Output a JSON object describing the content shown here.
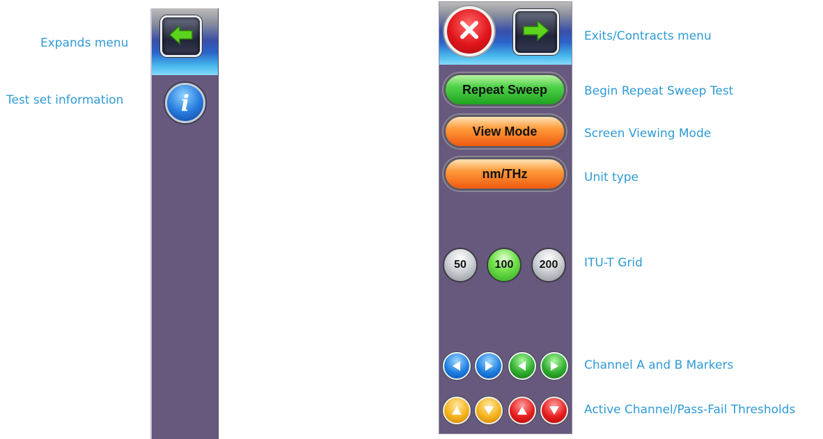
{
  "callouts": {
    "expands_menu": "Expands menu",
    "test_set_information": "Test set information",
    "exits_contracts_menu": "Exits/Contracts menu",
    "begin_repeat_sweep": "Begin Repeat Sweep Test",
    "screen_viewing_mode": "Screen Viewing Mode",
    "unit_type": "Unit type",
    "itu_t_grid": "ITU-T Grid",
    "channel_markers": "Channel A and B Markers",
    "active_channel_thresholds": "Active Channel/Pass-Fail Thresholds"
  },
  "collapsed_panel": {
    "expand_icon": "arrow-left-icon",
    "info_icon": "info-icon",
    "info_glyph": "i"
  },
  "expanded_panel": {
    "close_icon": "close-icon",
    "contract_icon": "arrow-right-icon",
    "repeat_sweep_label": "Repeat Sweep",
    "view_mode_label": "View Mode",
    "unit_label": "nm/THz",
    "grid_options": [
      "50",
      "100",
      "200"
    ],
    "grid_selected": "100",
    "markers": [
      {
        "icon": "triangle-left-icon",
        "color": "blue"
      },
      {
        "icon": "triangle-right-icon",
        "color": "blue"
      },
      {
        "icon": "triangle-left-icon",
        "color": "green"
      },
      {
        "icon": "triangle-right-icon",
        "color": "green"
      }
    ],
    "thresholds": [
      {
        "icon": "triangle-up-icon",
        "color": "yellow"
      },
      {
        "icon": "triangle-down-icon",
        "color": "yellow"
      },
      {
        "icon": "triangle-up-icon",
        "color": "red"
      },
      {
        "icon": "triangle-down-icon",
        "color": "red"
      }
    ]
  },
  "colors": {
    "callout_text": "#2e9ad6",
    "panel_bg": "#67597d",
    "arrow_green": "#5cd41e"
  }
}
